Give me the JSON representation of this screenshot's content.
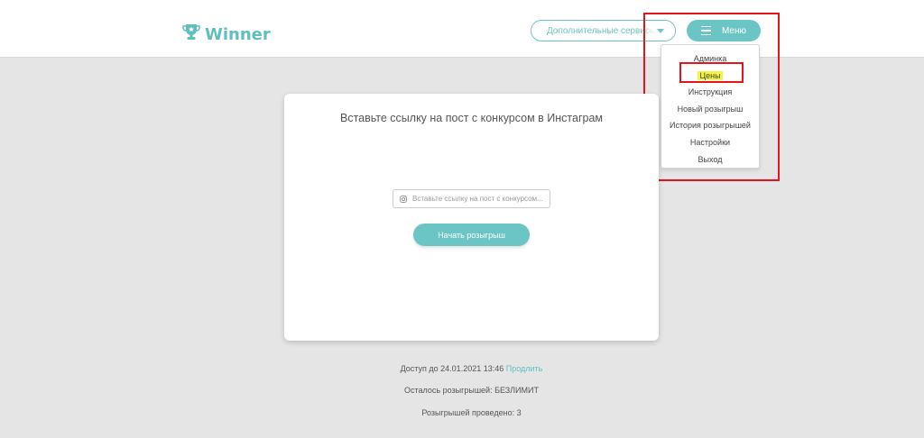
{
  "header": {
    "logo_text": "Winner",
    "services_label": "Дополнительные сервисы",
    "menu_label": "Меню"
  },
  "dropdown": {
    "items": [
      {
        "label": "Админка"
      },
      {
        "label": "Цены",
        "highlighted": true
      },
      {
        "label": "Инструкция"
      },
      {
        "label": "Новый розыгрыш"
      },
      {
        "label": "История розыгрышей"
      },
      {
        "label": "Настройки"
      },
      {
        "label": "Выход"
      }
    ]
  },
  "card": {
    "title": "Вставьте ссылку на пост с конкурсом в Инстаграм",
    "input_placeholder": "Вставьте ссылку на пост с конкурсом...",
    "input_value": "",
    "start_button_label": "Начать розыгрыш"
  },
  "info": {
    "access_text": "Доступ до 24.01.2021 13:46",
    "extend_link": "Продлить",
    "remaining_text": "Осталось розыгрышей: БЕЗЛИМИТ",
    "held_text": "Розыгрышей проведено: 3"
  },
  "colors": {
    "accent": "#6cc5c5",
    "background": "#e5e5e5",
    "highlight": "#f4f442",
    "annotation": "#e8141d"
  },
  "icons": {
    "logo": "trophy-icon",
    "services_caret": "caret-down-icon",
    "menu": "hamburger-icon",
    "input": "instagram-icon"
  }
}
